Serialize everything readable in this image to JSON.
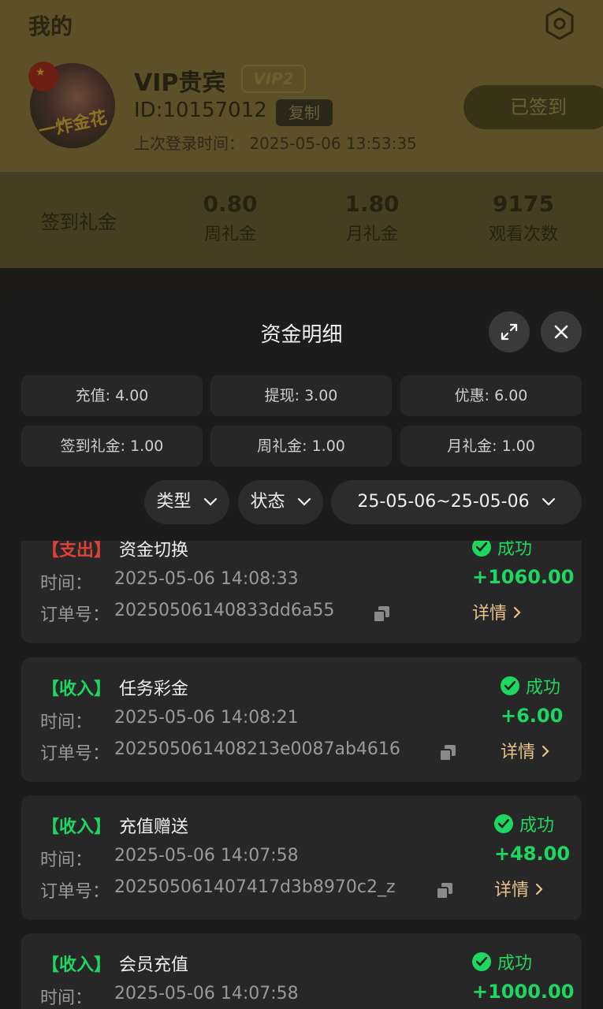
{
  "profile": {
    "page_title": "我的",
    "user_name": "VIP贵宾",
    "vip_level": "VIP2",
    "user_id": "ID:10157012",
    "copy_label": "复制",
    "last_login_label": "上次登录时间：",
    "last_login_time": "2025-05-06 13:53:35",
    "checkin_label": "已签到",
    "avatar_text": "一炸金花",
    "stats_title": "签到礼金",
    "stats": [
      {
        "value": "0.80",
        "label": "周礼金"
      },
      {
        "value": "1.80",
        "label": "月礼金"
      },
      {
        "value": "9175",
        "label": "观看次数"
      }
    ]
  },
  "sheet": {
    "title": "资金明细",
    "summary": [
      "充值: 4.00",
      "提现: 3.00",
      "优惠: 6.00",
      "签到礼金: 1.00",
      "周礼金: 1.00",
      "月礼金: 1.00"
    ],
    "filters": {
      "type": "类型",
      "status": "状态",
      "date_range": "25-05-06~25-05-06"
    },
    "labels": {
      "time": "时间：",
      "order": "订单号：",
      "detail": "详情"
    },
    "records": [
      {
        "tag": "【支出】",
        "tag_color": "#e0403a",
        "title": "资金切换",
        "time": "2025-05-06 14:08:33",
        "order": "20250506140833dd6a55",
        "status": "成功",
        "amount": "+1060.00"
      },
      {
        "tag": "【收入】",
        "tag_color": "#1ed760",
        "title": "任务彩金",
        "time": "2025-05-06 14:08:21",
        "order": "202505061408213e0087ab4616",
        "status": "成功",
        "amount": "+6.00"
      },
      {
        "tag": "【收入】",
        "tag_color": "#1ed760",
        "title": "充值赠送",
        "time": "2025-05-06 14:07:58",
        "order": "202505061407417d3b8970c2_z",
        "status": "成功",
        "amount": "+48.00"
      },
      {
        "tag": "【收入】",
        "tag_color": "#1ed760",
        "title": "会员充值",
        "time": "2025-05-06 14:07:58",
        "order": "",
        "status": "成功",
        "amount": "+1000.00"
      }
    ]
  },
  "colors": {
    "success": "#1ed760",
    "expense": "#e0403a",
    "detail_link": "#e8c38a"
  }
}
